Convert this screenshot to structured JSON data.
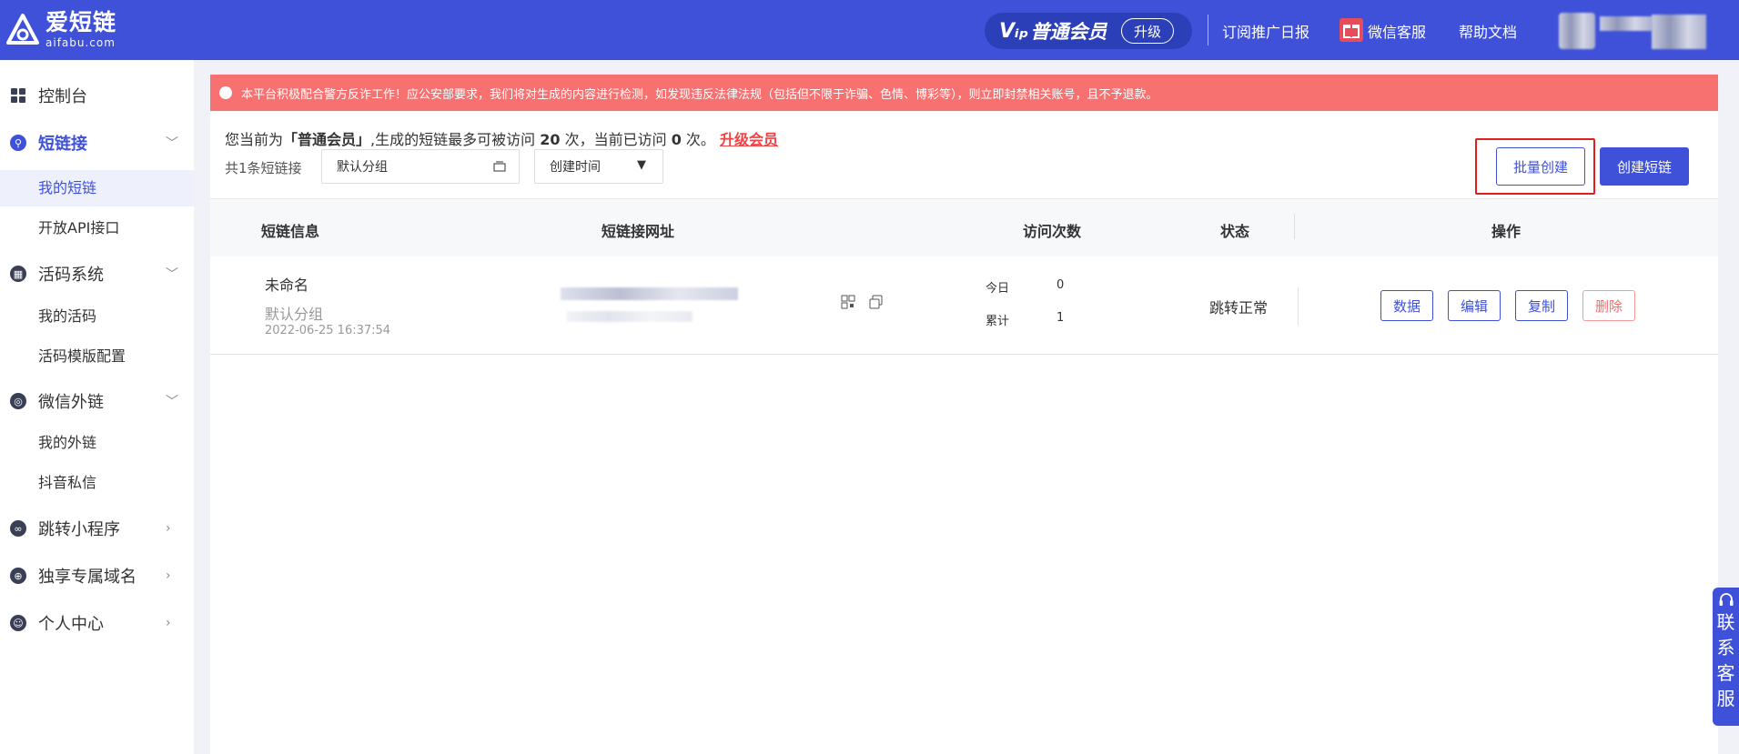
{
  "header": {
    "logo_name": "爱短链",
    "logo_sub": "aifabu.com",
    "vip_icon": "Vᵢₚ",
    "vip_label": "普通会员",
    "upgrade_label": "升级",
    "links": [
      "订阅推广日报",
      "微信客服",
      "帮助文档"
    ],
    "brand_color": "#3f51d9"
  },
  "sidebar": {
    "items": [
      {
        "label": "控制台",
        "icon": "dashboard-icon"
      },
      {
        "label": "短链接",
        "icon": "link-icon",
        "expanded": true,
        "children": [
          "我的短链",
          "开放API接口"
        ]
      },
      {
        "label": "活码系统",
        "icon": "qrcode-icon",
        "expanded": true,
        "children": [
          "我的活码",
          "活码模版配置"
        ]
      },
      {
        "label": "微信外链",
        "icon": "wechat-icon",
        "expanded": true,
        "children": [
          "我的外链",
          "抖音私信"
        ]
      },
      {
        "label": "跳转小程序",
        "icon": "miniprogram-icon"
      },
      {
        "label": "独享专属域名",
        "icon": "globe-icon"
      },
      {
        "label": "个人中心",
        "icon": "user-icon"
      }
    ],
    "active_child": "我的短链"
  },
  "alert": {
    "text": "本平台积极配合警方反诈工作！应公安部要求，我们将对生成的内容进行检测，如发现违反法律法规（包括但不限于诈骗、色情、博彩等），则立即封禁相关账号，且不予退款。"
  },
  "status": {
    "prefix": "您当前为",
    "level": "「普通会员」",
    "mid1": ",生成的短链最多可被访问",
    "limit": "20",
    "mid2": "次，当前已访问",
    "used": "0",
    "mid3": "次。",
    "upgrade_link": "升级会员"
  },
  "toolbar": {
    "count_label": "共1条短链接",
    "group_select": "默认分组",
    "sort_select": "创建时间",
    "batch_create": "批量创建",
    "create": "创建短链"
  },
  "table": {
    "headers": [
      "短链信息",
      "短链接网址",
      "访问次数",
      "状态",
      "操作"
    ],
    "rows": [
      {
        "name": "未命名",
        "group": "默认分组",
        "created": "2022-06-25 16:37:54",
        "today_label": "今日",
        "today": "0",
        "total_label": "累计",
        "total": "1",
        "status": "跳转正常",
        "actions": [
          "数据",
          "编辑",
          "复制",
          "删除"
        ]
      }
    ]
  },
  "contact": {
    "label": "联系客服"
  }
}
